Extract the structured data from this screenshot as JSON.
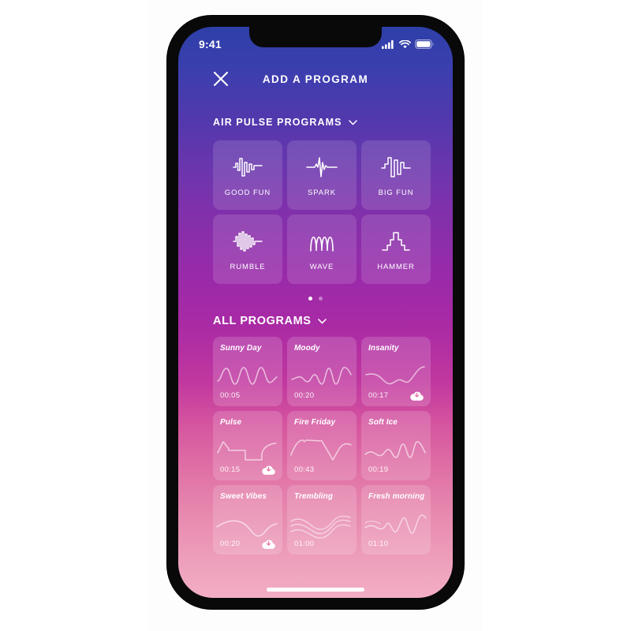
{
  "status_bar": {
    "time": "9:41",
    "icons": [
      "cellular-signal-icon",
      "wifi-icon",
      "battery-icon"
    ]
  },
  "nav": {
    "close_icon": "close-icon",
    "title": "ADD A PROGRAM"
  },
  "air_pulse_section": {
    "title": "AIR PULSE PROGRAMS",
    "chevron": "chevron-down-icon",
    "tiles": [
      {
        "label": "GOOD FUN",
        "icon": "waveform-good-fun-icon"
      },
      {
        "label": "SPARK",
        "icon": "waveform-spark-icon"
      },
      {
        "label": "BIG FUN",
        "icon": "waveform-big-fun-icon"
      },
      {
        "label": "RUMBLE",
        "icon": "waveform-rumble-icon"
      },
      {
        "label": "WAVE",
        "icon": "waveform-wave-icon"
      },
      {
        "label": "HAMMER",
        "icon": "waveform-hammer-icon"
      }
    ],
    "pager": {
      "total": 2,
      "active": 1
    }
  },
  "all_programs_section": {
    "title": "ALL PROGRAMS",
    "chevron": "chevron-down-icon",
    "cards": [
      {
        "name": "Sunny Day",
        "duration": "00:05",
        "download": false
      },
      {
        "name": "Moody",
        "duration": "00:20",
        "download": false
      },
      {
        "name": "Insanity",
        "duration": "00:17",
        "download": true
      },
      {
        "name": "Pulse",
        "duration": "00:15",
        "download": true
      },
      {
        "name": "Fire Friday",
        "duration": "00:43",
        "download": false
      },
      {
        "name": "Soft Ice",
        "duration": "00:19",
        "download": false
      },
      {
        "name": "Sweet Vibes",
        "duration": "00:20",
        "download": true
      },
      {
        "name": "Trembling",
        "duration": "01:00",
        "download": false
      },
      {
        "name": "Fresh morning",
        "duration": "01:10",
        "download": false
      }
    ]
  },
  "colors": {
    "gradient_top": "#2e3fa8",
    "gradient_mid": "#a92aa5",
    "gradient_bottom": "#f2aec4",
    "text": "#ffffff",
    "tile_fill": "rgba(255,255,255,0.13)",
    "frame": "#090909"
  }
}
